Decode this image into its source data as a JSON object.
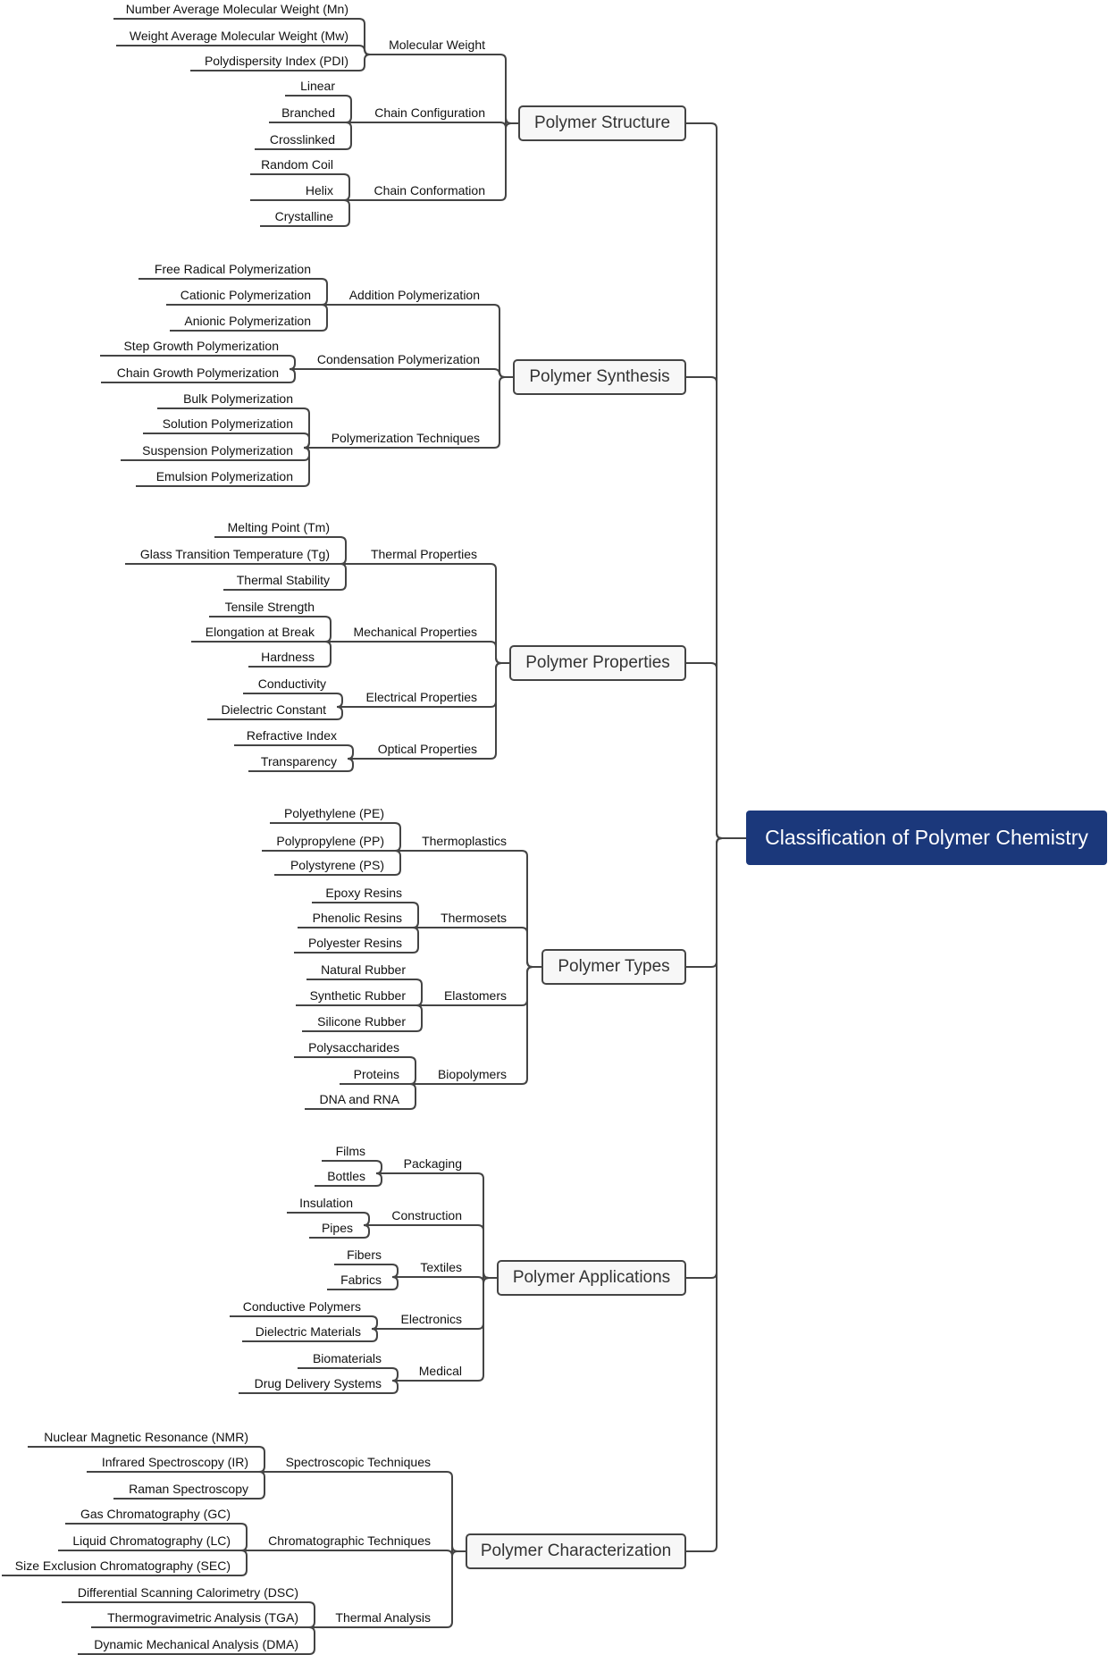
{
  "title": "Classification of Polymer Chemistry",
  "colors": {
    "root_fill": "#1b387b",
    "root_text": "#ffffff",
    "node_fill": "#f7f7f7",
    "line": "#444444"
  },
  "branches": [
    {
      "label": "Polymer Structure",
      "children": [
        {
          "label": "Molecular Weight",
          "children": [
            "Number Average Molecular Weight (Mn)",
            "Weight Average Molecular Weight (Mw)",
            "Polydispersity Index (PDI)"
          ]
        },
        {
          "label": "Chain Configuration",
          "children": [
            "Linear",
            "Branched",
            "Crosslinked"
          ]
        },
        {
          "label": "Chain Conformation",
          "children": [
            "Random Coil",
            "Helix",
            "Crystalline"
          ]
        }
      ]
    },
    {
      "label": "Polymer Synthesis",
      "children": [
        {
          "label": "Addition Polymerization",
          "children": [
            "Free Radical Polymerization",
            "Cationic Polymerization",
            "Anionic Polymerization"
          ]
        },
        {
          "label": "Condensation Polymerization",
          "children": [
            "Step Growth Polymerization",
            "Chain Growth Polymerization"
          ]
        },
        {
          "label": "Polymerization Techniques",
          "children": [
            "Bulk Polymerization",
            "Solution Polymerization",
            "Suspension Polymerization",
            "Emulsion Polymerization"
          ]
        }
      ]
    },
    {
      "label": "Polymer Properties",
      "children": [
        {
          "label": "Thermal Properties",
          "children": [
            "Melting Point (Tm)",
            "Glass Transition Temperature (Tg)",
            "Thermal Stability"
          ]
        },
        {
          "label": "Mechanical Properties",
          "children": [
            "Tensile Strength",
            "Elongation at Break",
            "Hardness"
          ]
        },
        {
          "label": "Electrical Properties",
          "children": [
            "Conductivity",
            "Dielectric Constant"
          ]
        },
        {
          "label": "Optical Properties",
          "children": [
            "Refractive Index",
            "Transparency"
          ]
        }
      ]
    },
    {
      "label": "Polymer Types",
      "children": [
        {
          "label": "Thermoplastics",
          "children": [
            "Polyethylene (PE)",
            "Polypropylene (PP)",
            "Polystyrene (PS)"
          ]
        },
        {
          "label": "Thermosets",
          "children": [
            "Epoxy Resins",
            "Phenolic Resins",
            "Polyester Resins"
          ]
        },
        {
          "label": "Elastomers",
          "children": [
            "Natural Rubber",
            "Synthetic Rubber",
            "Silicone Rubber"
          ]
        },
        {
          "label": "Biopolymers",
          "children": [
            "Polysaccharides",
            "Proteins",
            "DNA and RNA"
          ]
        }
      ]
    },
    {
      "label": "Polymer Applications",
      "children": [
        {
          "label": "Packaging",
          "children": [
            "Films",
            "Bottles"
          ]
        },
        {
          "label": "Construction",
          "children": [
            "Insulation",
            "Pipes"
          ]
        },
        {
          "label": "Textiles",
          "children": [
            "Fibers",
            "Fabrics"
          ]
        },
        {
          "label": "Electronics",
          "children": [
            "Conductive Polymers",
            "Dielectric Materials"
          ]
        },
        {
          "label": "Medical",
          "children": [
            "Biomaterials",
            "Drug Delivery Systems"
          ]
        }
      ]
    },
    {
      "label": "Polymer Characterization",
      "children": [
        {
          "label": "Spectroscopic Techniques",
          "children": [
            "Nuclear Magnetic Resonance (NMR)",
            "Infrared Spectroscopy (IR)",
            "Raman Spectroscopy"
          ]
        },
        {
          "label": "Chromatographic Techniques",
          "children": [
            "Gas Chromatography (GC)",
            "Liquid Chromatography (LC)",
            "Size Exclusion Chromatography (SEC)"
          ]
        },
        {
          "label": "Thermal Analysis",
          "children": [
            "Differential Scanning Calorimetry (DSC)",
            "Thermogravimetric Analysis (TGA)",
            "Dynamic Mechanical Analysis (DMA)"
          ]
        }
      ]
    }
  ]
}
